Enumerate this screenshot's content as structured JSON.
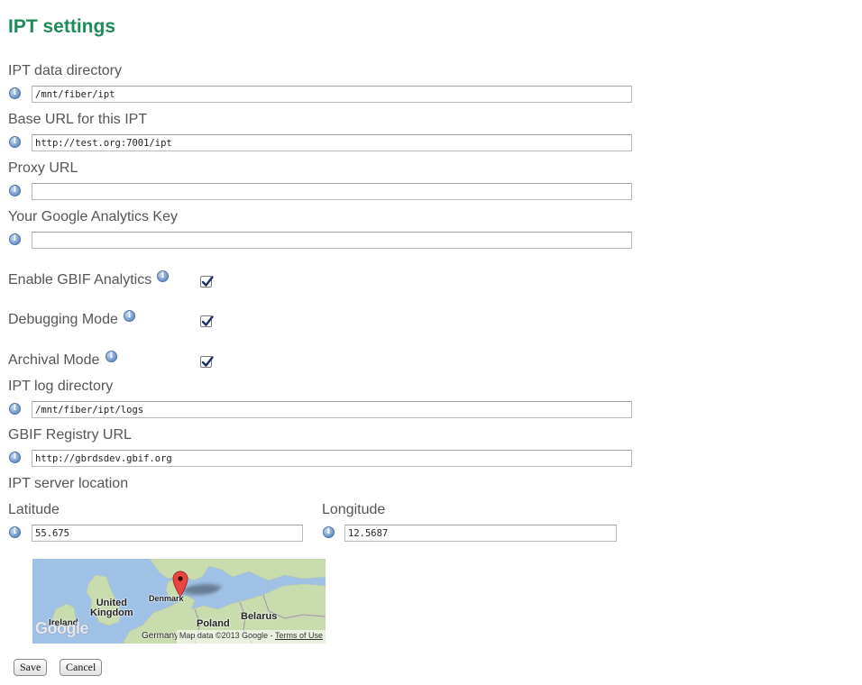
{
  "page": {
    "title": "IPT settings"
  },
  "fields": {
    "data_dir": {
      "label": "IPT data directory",
      "value": "/mnt/fiber/ipt"
    },
    "base_url": {
      "label": "Base URL for this IPT",
      "value": "http://test.org:7001/ipt"
    },
    "proxy_url": {
      "label": "Proxy URL",
      "value": ""
    },
    "ga_key": {
      "label": "Your Google Analytics Key",
      "value": ""
    },
    "log_dir": {
      "label": "IPT log directory",
      "value": "/mnt/fiber/ipt/logs"
    },
    "registry_url": {
      "label": "GBIF Registry URL",
      "value": "http://gbrdsdev.gbif.org"
    }
  },
  "checkboxes": {
    "gbif_analytics": {
      "label": "Enable GBIF Analytics",
      "checked": true
    },
    "debugging": {
      "label": "Debugging Mode",
      "checked": true
    },
    "archival": {
      "label": "Archival Mode",
      "checked": true
    }
  },
  "location": {
    "section_label": "IPT server location",
    "latitude": {
      "label": "Latitude",
      "value": "55.675"
    },
    "longitude": {
      "label": "Longitude",
      "value": "12.5687"
    }
  },
  "map": {
    "labels": {
      "united_kingdom": "United\nKingdom",
      "ireland": "Ireland",
      "denmark": "Denmark",
      "poland": "Poland",
      "belarus": "Belarus",
      "germany": "Germany"
    },
    "logo": "Google",
    "attribution": "Map data ©2013 Google",
    "separator": "-",
    "terms_link": "Terms of Use"
  },
  "icons": {
    "info": "i"
  },
  "buttons": {
    "save": "Save",
    "cancel": "Cancel"
  },
  "colors": {
    "title": "#1d8a5a",
    "land": "#c9dcae",
    "water": "#9fc1e6",
    "marker": "#e8463f"
  }
}
